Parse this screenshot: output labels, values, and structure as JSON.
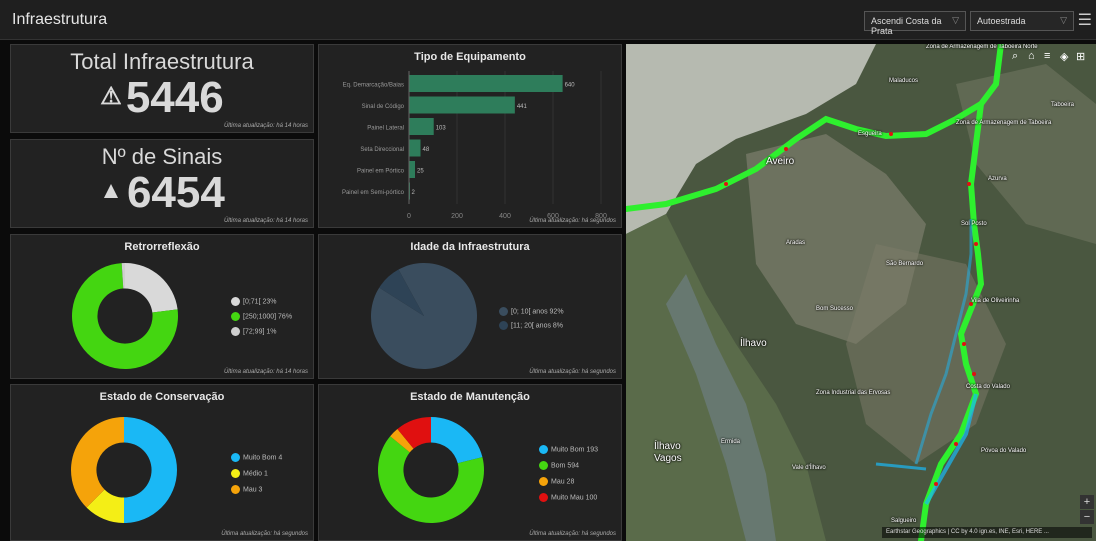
{
  "header": {
    "title": "Infraestrutura",
    "filter1": "Ascendi Costa da Prata",
    "filter2": "Autoestrada"
  },
  "kpi_total": {
    "label": "Total Infraestrutura",
    "value": "5446",
    "updated": "Última atualização: há 14 horas"
  },
  "kpi_sinais": {
    "label": "Nº de Sinais",
    "value": "6454",
    "updated": "Última atualização: há 14 horas"
  },
  "chart_tipo": {
    "updated": "Última atualização: há segundos"
  },
  "chart_retro": {
    "updated": "Última atualização: há 14 horas"
  },
  "chart_idade": {
    "updated": "Última atualização: há segundos"
  },
  "chart_conservacao": {
    "updated": "Última atualização: há segundos"
  },
  "chart_manutencao": {
    "updated": "Última atualização: há segundos"
  },
  "chart_data": [
    {
      "id": "tipo",
      "type": "bar",
      "orientation": "horizontal",
      "title": "Tipo de Equipamento",
      "categories": [
        "Eq. Demarcação/Baias",
        "Sinal de Código",
        "Painel Lateral",
        "Seta Direccional",
        "Painel em Pórtico",
        "Painel em Semi-pórtico"
      ],
      "values": [
        640,
        441,
        103,
        48,
        25,
        2
      ],
      "xlim": [
        0,
        800
      ],
      "xticks": [
        0,
        200,
        400,
        600,
        800
      ],
      "color": "#2e7d5b",
      "grid": true
    },
    {
      "id": "retro",
      "type": "pie",
      "donut": true,
      "title": "Retrorreflexão",
      "labels": [
        "[0;71[",
        "[250;1000]",
        "[72;99]"
      ],
      "legend": [
        "[0;71[  23%",
        "[250;1000]  76%",
        "[72;99]  1%"
      ],
      "values": [
        23,
        76,
        1
      ],
      "colors": [
        "#d9d9d9",
        "#44d611",
        "#cfcfcf"
      ]
    },
    {
      "id": "idade",
      "type": "pie",
      "donut": false,
      "title": "Idade da Infraestrutura",
      "labels": [
        "[0; 10[ anos",
        "[11; 20[ anos"
      ],
      "legend": [
        "[0; 10[ anos  92%",
        "[11; 20[ anos  8%"
      ],
      "values": [
        92,
        8
      ],
      "colors": [
        "#3a4d5e",
        "#2e4356"
      ]
    },
    {
      "id": "conservacao",
      "type": "pie",
      "donut": true,
      "title": "Estado de Conservação",
      "labels": [
        "Muito Bom",
        "Médio",
        "Mau"
      ],
      "legend": [
        "Muito Bom  4",
        "Médio  1",
        "Mau  3"
      ],
      "values": [
        4,
        1,
        3
      ],
      "colors": [
        "#1ab8f5",
        "#f4ee16",
        "#f5a30a"
      ]
    },
    {
      "id": "manutencao",
      "type": "pie",
      "donut": true,
      "title": "Estado de Manutenção",
      "labels": [
        "Muito Bom",
        "Bom",
        "Mau",
        "Muito Mau"
      ],
      "legend": [
        "Muito Bom  193",
        "Bom  594",
        "Mau  28",
        "Muito Mau  100"
      ],
      "values": [
        193,
        594,
        28,
        100
      ],
      "colors": [
        "#1ab8f5",
        "#44d611",
        "#f5a30a",
        "#e01010"
      ]
    }
  ],
  "map": {
    "places": [
      {
        "name": "Zona de Armazenagem de Taboeira Norte"
      },
      {
        "name": "Maladucos"
      },
      {
        "name": "Taboeira"
      },
      {
        "name": "Esgueira"
      },
      {
        "name": "Zona de Armazenagem de Taboeira"
      },
      {
        "name": "Aveiro"
      },
      {
        "name": "Azurva"
      },
      {
        "name": "Sol Posto"
      },
      {
        "name": "Aradas"
      },
      {
        "name": "São Bernardo"
      },
      {
        "name": "Vila de Oliveirinha"
      },
      {
        "name": "Bom Sucesso"
      },
      {
        "name": "Ílhavo"
      },
      {
        "name": "Zona Industrial das Ervosas"
      },
      {
        "name": "Costa do Valado"
      },
      {
        "name": "Ílhavo"
      },
      {
        "name": "Vagos"
      },
      {
        "name": "Ermida"
      },
      {
        "name": "Vale d'Ílhavo"
      },
      {
        "name": "Póvoa do Valado"
      },
      {
        "name": "Salgueiro"
      }
    ],
    "attribution": "Earthstar Geographics | CC by 4.0 ign.es, INE, Esri, HERE ..."
  }
}
